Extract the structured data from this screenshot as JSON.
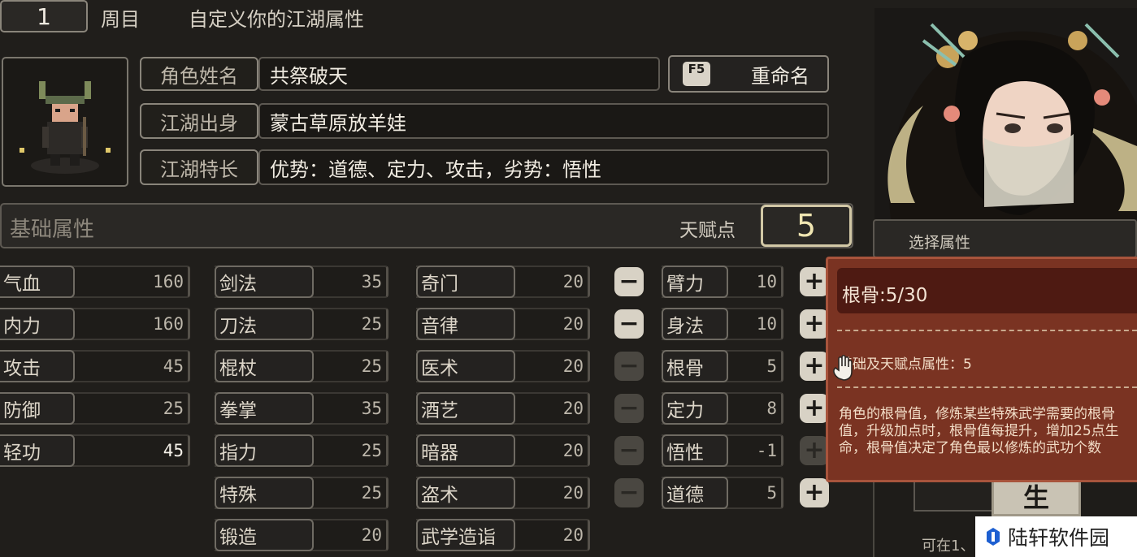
{
  "header": {
    "round_number": "1",
    "round_label": "周目",
    "title": "自定义你的江湖属性"
  },
  "profile": {
    "rows": [
      {
        "label": "角色姓名",
        "value": "共祭破天"
      },
      {
        "label": "江湖出身",
        "value": "蒙古草原放羊娃"
      },
      {
        "label": "江湖特长",
        "value": "优势：道德、定力、攻击，劣势：悟性"
      }
    ],
    "rename": {
      "key": "F5",
      "label": "重命名"
    }
  },
  "base_attr": {
    "title": "基础属性",
    "talent_label": "天赋点",
    "talent_points": "5"
  },
  "col1": [
    {
      "name": "气血",
      "value": "160"
    },
    {
      "name": "内力",
      "value": "160"
    },
    {
      "name": "攻击",
      "value": "45"
    },
    {
      "name": "防御",
      "value": "25"
    },
    {
      "name": "轻功",
      "value": "45"
    }
  ],
  "col2": [
    {
      "name": "剑法",
      "value": "35"
    },
    {
      "name": "刀法",
      "value": "25"
    },
    {
      "name": "棍杖",
      "value": "25"
    },
    {
      "name": "拳掌",
      "value": "35"
    },
    {
      "name": "指力",
      "value": "25"
    },
    {
      "name": "特殊",
      "value": "25"
    },
    {
      "name": "锻造",
      "value": "20"
    }
  ],
  "col3": [
    {
      "name": "奇门",
      "value": "20"
    },
    {
      "name": "音律",
      "value": "20"
    },
    {
      "name": "医术",
      "value": "20"
    },
    {
      "name": "酒艺",
      "value": "20"
    },
    {
      "name": "暗器",
      "value": "20"
    },
    {
      "name": "盗术",
      "value": "20"
    },
    {
      "name": "武学造诣",
      "value": "20"
    }
  ],
  "col4": [
    {
      "name": "臂力",
      "value": "10"
    },
    {
      "name": "身法",
      "value": "10"
    },
    {
      "name": "根骨",
      "value": "5"
    },
    {
      "name": "定力",
      "value": "8"
    },
    {
      "name": "悟性",
      "value": "-1"
    },
    {
      "name": "道德",
      "value": "5"
    }
  ],
  "controls": {
    "minus": "−",
    "plus": "+"
  },
  "right_panel": {
    "select_label": "选择属性",
    "bottom_text": "可在1、",
    "emblem": "生"
  },
  "tooltip": {
    "title": "根骨:5/30",
    "base_line": "基础及天赋点属性：5",
    "desc": "角色的根骨值，修炼某些特殊武学需要的根骨值，升级加点时，根骨值每提升，增加25点生命，根骨值决定了角色最以修炼的武功个数"
  },
  "watermark": {
    "text": "陆轩软件园"
  },
  "colors": {
    "tooltip_bg": "#7a3322",
    "tooltip_header": "#4e1a12",
    "panel_bg": "#201e1b"
  }
}
